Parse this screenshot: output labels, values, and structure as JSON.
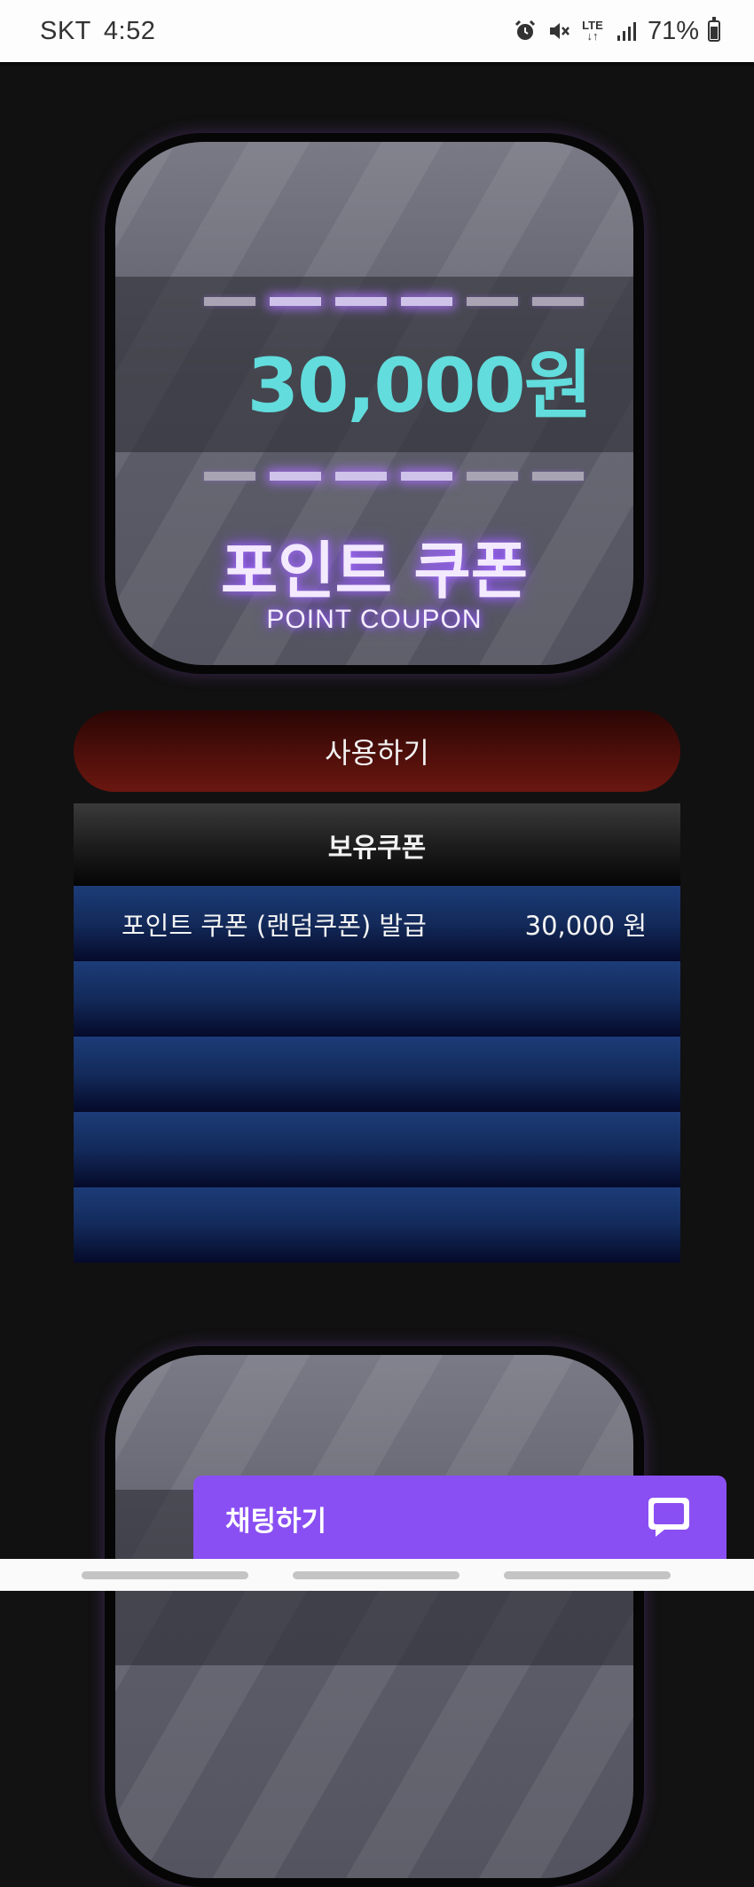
{
  "status_bar": {
    "carrier": "SKT",
    "time": "4:52",
    "network": "LTE",
    "battery": "71%",
    "icons": [
      "alarm-icon",
      "mute-icon",
      "lte-icon",
      "signal-icon",
      "battery-icon"
    ]
  },
  "coupon_card": {
    "amount": "30,000원",
    "title": "포인트 쿠폰",
    "subtitle": "POINT COUPON"
  },
  "use_button": {
    "label": "사용하기"
  },
  "owned_coupons": {
    "header": "보유쿠폰",
    "rows": [
      {
        "name": "포인트 쿠폰 (랜덤쿠폰) 발급",
        "amount": "30,000 원"
      },
      {
        "name": "",
        "amount": ""
      },
      {
        "name": "",
        "amount": ""
      },
      {
        "name": "",
        "amount": ""
      },
      {
        "name": "",
        "amount": ""
      }
    ]
  },
  "chat_button": {
    "label": "채팅하기",
    "icon": "chat-bubble-icon"
  },
  "colors": {
    "amount": "#62dcdc",
    "chat_button": "#8a4ff3",
    "use_button": "#52100b",
    "row_blue": "#1c3c78"
  }
}
